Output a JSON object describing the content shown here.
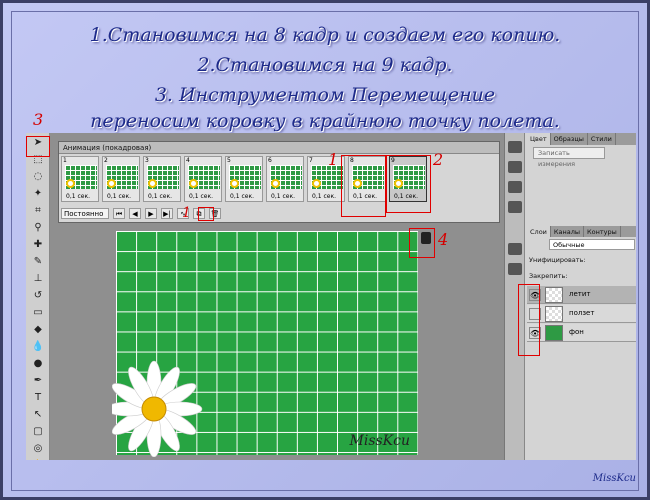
{
  "instructions": {
    "line1": "1.Становимся на 8 кадр и создаем его копию.",
    "line2": "2.Становимся на 9 кадр.",
    "line3": "3. Инструментом Перемещение",
    "line4": "переносим коровку в крайнюю точку полета."
  },
  "annotations": {
    "n1": "1",
    "n2": "2",
    "n3": "3",
    "n4": "4",
    "n1b": "1"
  },
  "animation_panel": {
    "title": "Анимация (покадровая)",
    "frames": [
      {
        "num": "1",
        "time": "0,1 сек."
      },
      {
        "num": "2",
        "time": "0,1 сек."
      },
      {
        "num": "3",
        "time": "0,1 сек."
      },
      {
        "num": "4",
        "time": "0,1 сек."
      },
      {
        "num": "5",
        "time": "0,1 сек."
      },
      {
        "num": "6",
        "time": "0,1 сек."
      },
      {
        "num": "7",
        "time": "0,1 сек."
      },
      {
        "num": "8",
        "time": "0,1 сек."
      },
      {
        "num": "9",
        "time": "0,1 сек."
      }
    ],
    "loop": "Постоянно"
  },
  "canvas": {
    "watermark": "MissKcu"
  },
  "right_panel": {
    "tabs": [
      "Цвет",
      "Образцы",
      "Стили"
    ],
    "measure_btn": "Записать измерения",
    "layer_tabs": [
      "Слои",
      "Каналы",
      "Контуры"
    ],
    "blend_mode": "Обычные",
    "unify_label": "Унифицировать:",
    "lock_label": "Закрепить:",
    "layers": [
      {
        "name": "летит"
      },
      {
        "name": "ползет"
      },
      {
        "name": "фон"
      }
    ]
  },
  "footer": {
    "signature": "MissKcu"
  }
}
